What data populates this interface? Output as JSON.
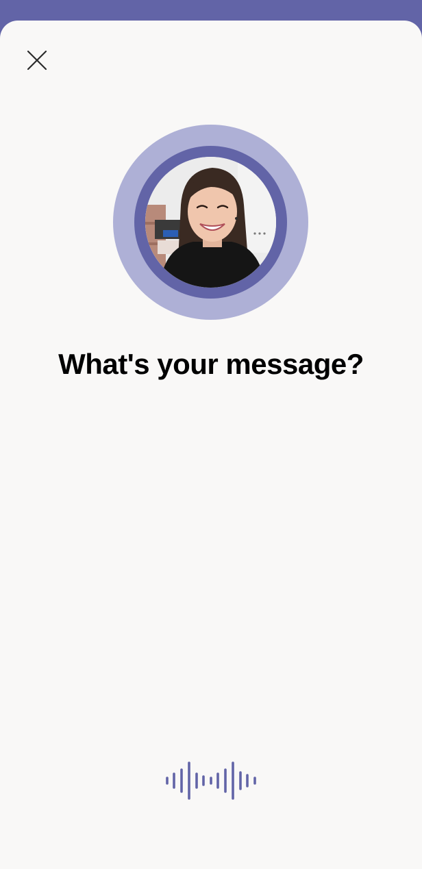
{
  "app": {
    "accent_color": "#6264a7",
    "accent_light_color": "#aeb0d6",
    "background_color": "#f9f8f7"
  },
  "header": {
    "close_icon": "close-icon"
  },
  "recipient": {
    "avatar_icon": "profile-photo"
  },
  "prompt": {
    "text": "What's your message?"
  },
  "voice": {
    "icon": "voice-waveform-icon"
  }
}
